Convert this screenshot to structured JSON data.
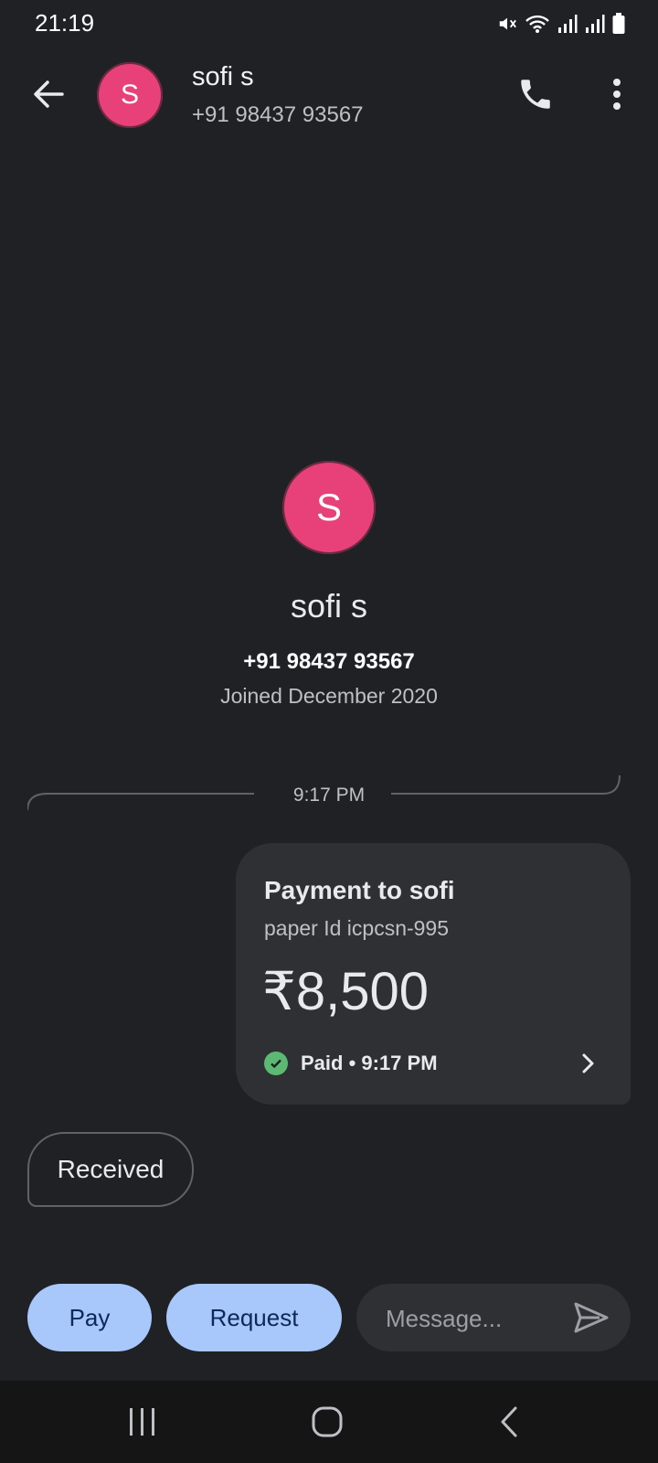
{
  "status_bar": {
    "time": "21:19",
    "icons": [
      "mute-icon",
      "wifi-icon",
      "signal-icon",
      "signal-icon",
      "battery-icon"
    ]
  },
  "header": {
    "avatar_letter": "S",
    "name": "sofi s",
    "phone": "+91 98437 93567"
  },
  "profile": {
    "avatar_letter": "S",
    "name": "sofi s",
    "phone": "+91 98437 93567",
    "joined": "Joined December 2020"
  },
  "conversation": {
    "timestamp": "9:17 PM",
    "payment": {
      "title": "Payment to sofi",
      "note": "paper Id icpcsn-995",
      "amount": "₹8,500",
      "status": "Paid • 9:17 PM"
    },
    "received_label": "Received"
  },
  "actions": {
    "pay_label": "Pay",
    "request_label": "Request",
    "message_placeholder": "Message..."
  },
  "colors": {
    "background": "#202124",
    "avatar": "#e8417a",
    "button": "#a8c7fa",
    "paid_check": "#5bb974"
  }
}
